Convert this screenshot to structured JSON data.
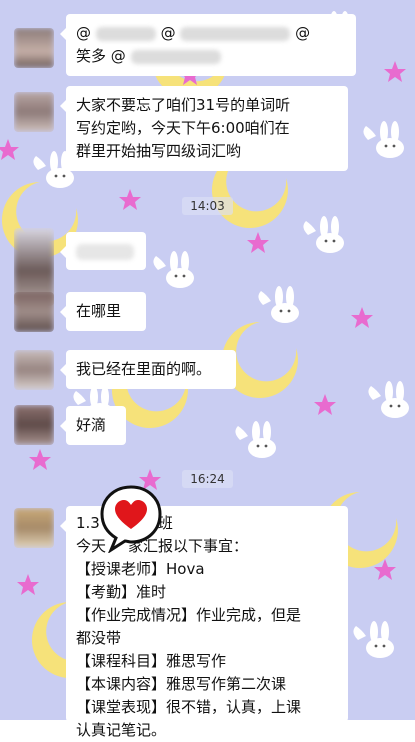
{
  "messages": [
    {
      "line1_prefix": "@",
      "line1_mid": "@",
      "line1_suffix": "@",
      "line2": "笑多 @"
    },
    {
      "lines": [
        "大家不要忘了咱们31号的单词听",
        "写约定哟，今天下午6:00咱们在",
        "群里开始抽写四级词汇哟"
      ]
    },
    {
      "time": "14:03"
    },
    {
      "text": "在哪里"
    },
    {
      "text": "我已经在里面的啊。"
    },
    {
      "text": "好滴"
    },
    {
      "time": "16:24"
    },
    {
      "lines": [
        "1.3",
        "今天",
        "家汇报以下事宜：",
        "【授课老师】Hova",
        "【考勤】准时",
        "【作业完成情况】作业完成，但是",
        "都没带",
        "【课程科目】雅思写作",
        "【本课内容】雅思写作第二次课",
        "【课堂表现】很不错，认真，上课",
        "认真记笔记。"
      ],
      "line1_tail": "班"
    }
  ],
  "icons": {
    "heart": "heart-icon",
    "stars": "star-icon",
    "moon": "moon-icon",
    "bunny": "bunny-icon"
  },
  "colors": {
    "background": "#c9cdf2",
    "star": "#e86bcf",
    "moon": "#f6e27a",
    "heart": "#e0161b"
  }
}
